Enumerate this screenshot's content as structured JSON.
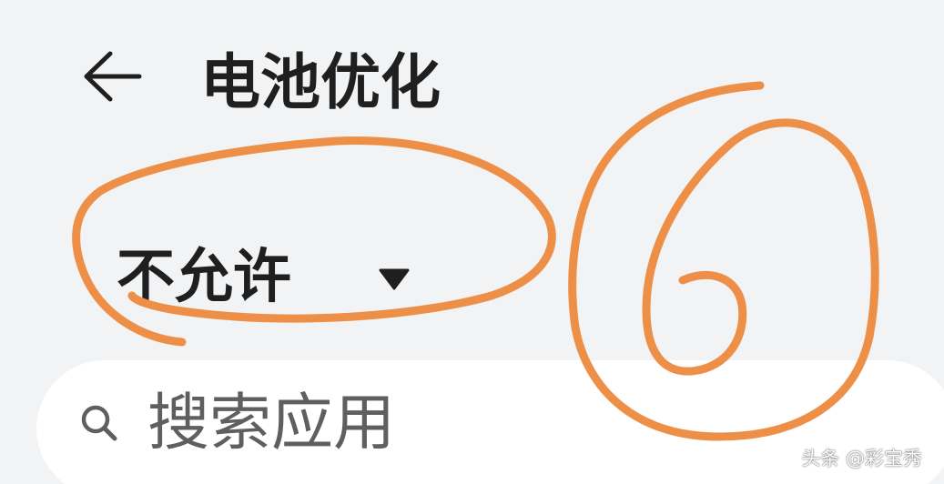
{
  "header": {
    "back_icon": "arrow-left-icon",
    "title": "电池优化"
  },
  "filter": {
    "selected": "不允许",
    "dropdown_icon": "triangle-down-icon"
  },
  "search": {
    "icon": "search-icon",
    "placeholder": "搜索应用"
  },
  "annotation": {
    "step_number": "6",
    "color": "#ee8f48"
  },
  "watermark": {
    "text": "头条 @彩宝秀"
  },
  "colors": {
    "background": "#f1f3f5",
    "search_background": "#ffffff",
    "text_primary": "#1f1f1f",
    "text_placeholder": "#5f5f5f"
  }
}
